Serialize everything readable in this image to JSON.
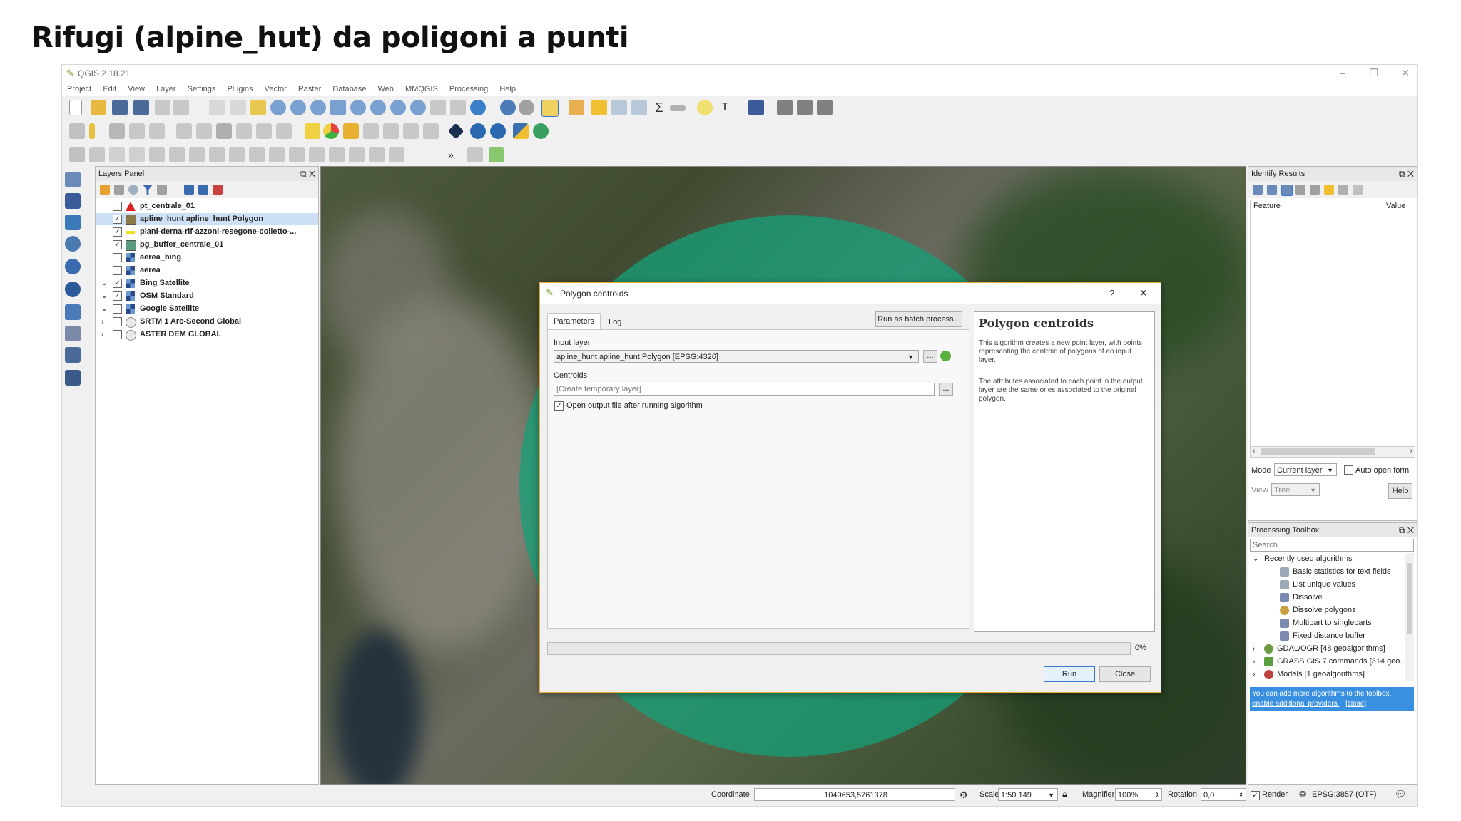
{
  "slide": {
    "title": "Rifugi (alpine_hut) da poligoni a punti"
  },
  "window": {
    "title": "QGIS 2.18.21"
  },
  "menu": [
    "Project",
    "Edit",
    "View",
    "Layer",
    "Settings",
    "Plugins",
    "Vector",
    "Raster",
    "Database",
    "Web",
    "MMQGIS",
    "Processing",
    "Help"
  ],
  "layers_panel": {
    "title": "Layers Panel",
    "layers": [
      {
        "name": "pt_centrale_01",
        "checked": false,
        "symbol": "red-triangle",
        "expander": ""
      },
      {
        "name": "apline_hunt apline_hunt Polygon",
        "checked": true,
        "symbol": "brown-square",
        "expander": "",
        "selected": true
      },
      {
        "name": "piani-derna-rif-azzoni-resegone-colletto-...",
        "checked": true,
        "symbol": "yellow-line",
        "expander": ""
      },
      {
        "name": "pg_buffer_centrale_01",
        "checked": true,
        "symbol": "green-square",
        "expander": ""
      },
      {
        "name": "aerea_bing",
        "checked": false,
        "symbol": "raster-grid",
        "expander": ""
      },
      {
        "name": "aerea",
        "checked": false,
        "symbol": "raster-grid",
        "expander": ""
      },
      {
        "name": "Bing Satellite",
        "checked": true,
        "symbol": "raster-grid",
        "expander": "⌄"
      },
      {
        "name": "OSM Standard",
        "checked": true,
        "symbol": "raster-grid",
        "expander": "⌄"
      },
      {
        "name": "Google Satellite",
        "checked": false,
        "symbol": "raster-grid",
        "expander": "⌄"
      },
      {
        "name": "SRTM 1 Arc-Second Global",
        "checked": false,
        "symbol": "wcs",
        "expander": "›"
      },
      {
        "name": "ASTER DEM GLOBAL",
        "checked": false,
        "symbol": "wcs",
        "expander": "›"
      }
    ]
  },
  "identify": {
    "title": "Identify Results",
    "col_feature": "Feature",
    "col_value": "Value",
    "mode_label": "Mode",
    "mode_value": "Current layer",
    "auto_open": "Auto open form",
    "view_label": "View",
    "view_value": "Tree",
    "help": "Help"
  },
  "toolbox": {
    "title": "Processing Toolbox",
    "search_placeholder": "Search...",
    "recent": "Recently used algorithms",
    "items": [
      "Basic statistics for text fields",
      "List unique values",
      "Dissolve",
      "Dissolve polygons",
      "Multipart to singleparts",
      "Fixed distance buffer"
    ],
    "groups": [
      "GDAL/OGR [48 geoalgorithms]",
      "GRASS GIS 7 commands [314 geo...",
      "Models [1 geoalgorithms]"
    ],
    "note_text": "You can add more algorithms to the toolbox,",
    "note_link": "enable additional providers.",
    "note_close": "[close]"
  },
  "dialog": {
    "title": "Polygon centroids",
    "help": "?",
    "close_x": "✕",
    "tab_params": "Parameters",
    "tab_log": "Log",
    "batch": "Run as batch process...",
    "input_layer_label": "Input layer",
    "input_layer_value": "apline_hunt apline_hunt Polygon [EPSG:4326]",
    "centroids_label": "Centroids",
    "centroids_placeholder": "[Create temporary layer]",
    "open_output": "Open output file after running algorithm",
    "dots": "...",
    "help_title": "Polygon centroids",
    "help_p1": "This algorithm creates a new point layer, with points representing the centroid of polygons of an input layer.",
    "help_p2": "The attributes associated to each point in the output layer are the same ones associated to the original polygon.",
    "progress": 0,
    "progress_text": "0%",
    "run": "Run",
    "close": "Close"
  },
  "status": {
    "coordinate_label": "Coordinate",
    "coordinate": "1049653,5761378",
    "scale_label": "Scale",
    "scale": "1:50.149",
    "magnifier_label": "Magnifier",
    "magnifier": "100%",
    "rotation_label": "Rotation",
    "rotation": "0,0",
    "render": "Render",
    "crs": "EPSG:3857 (OTF)"
  }
}
